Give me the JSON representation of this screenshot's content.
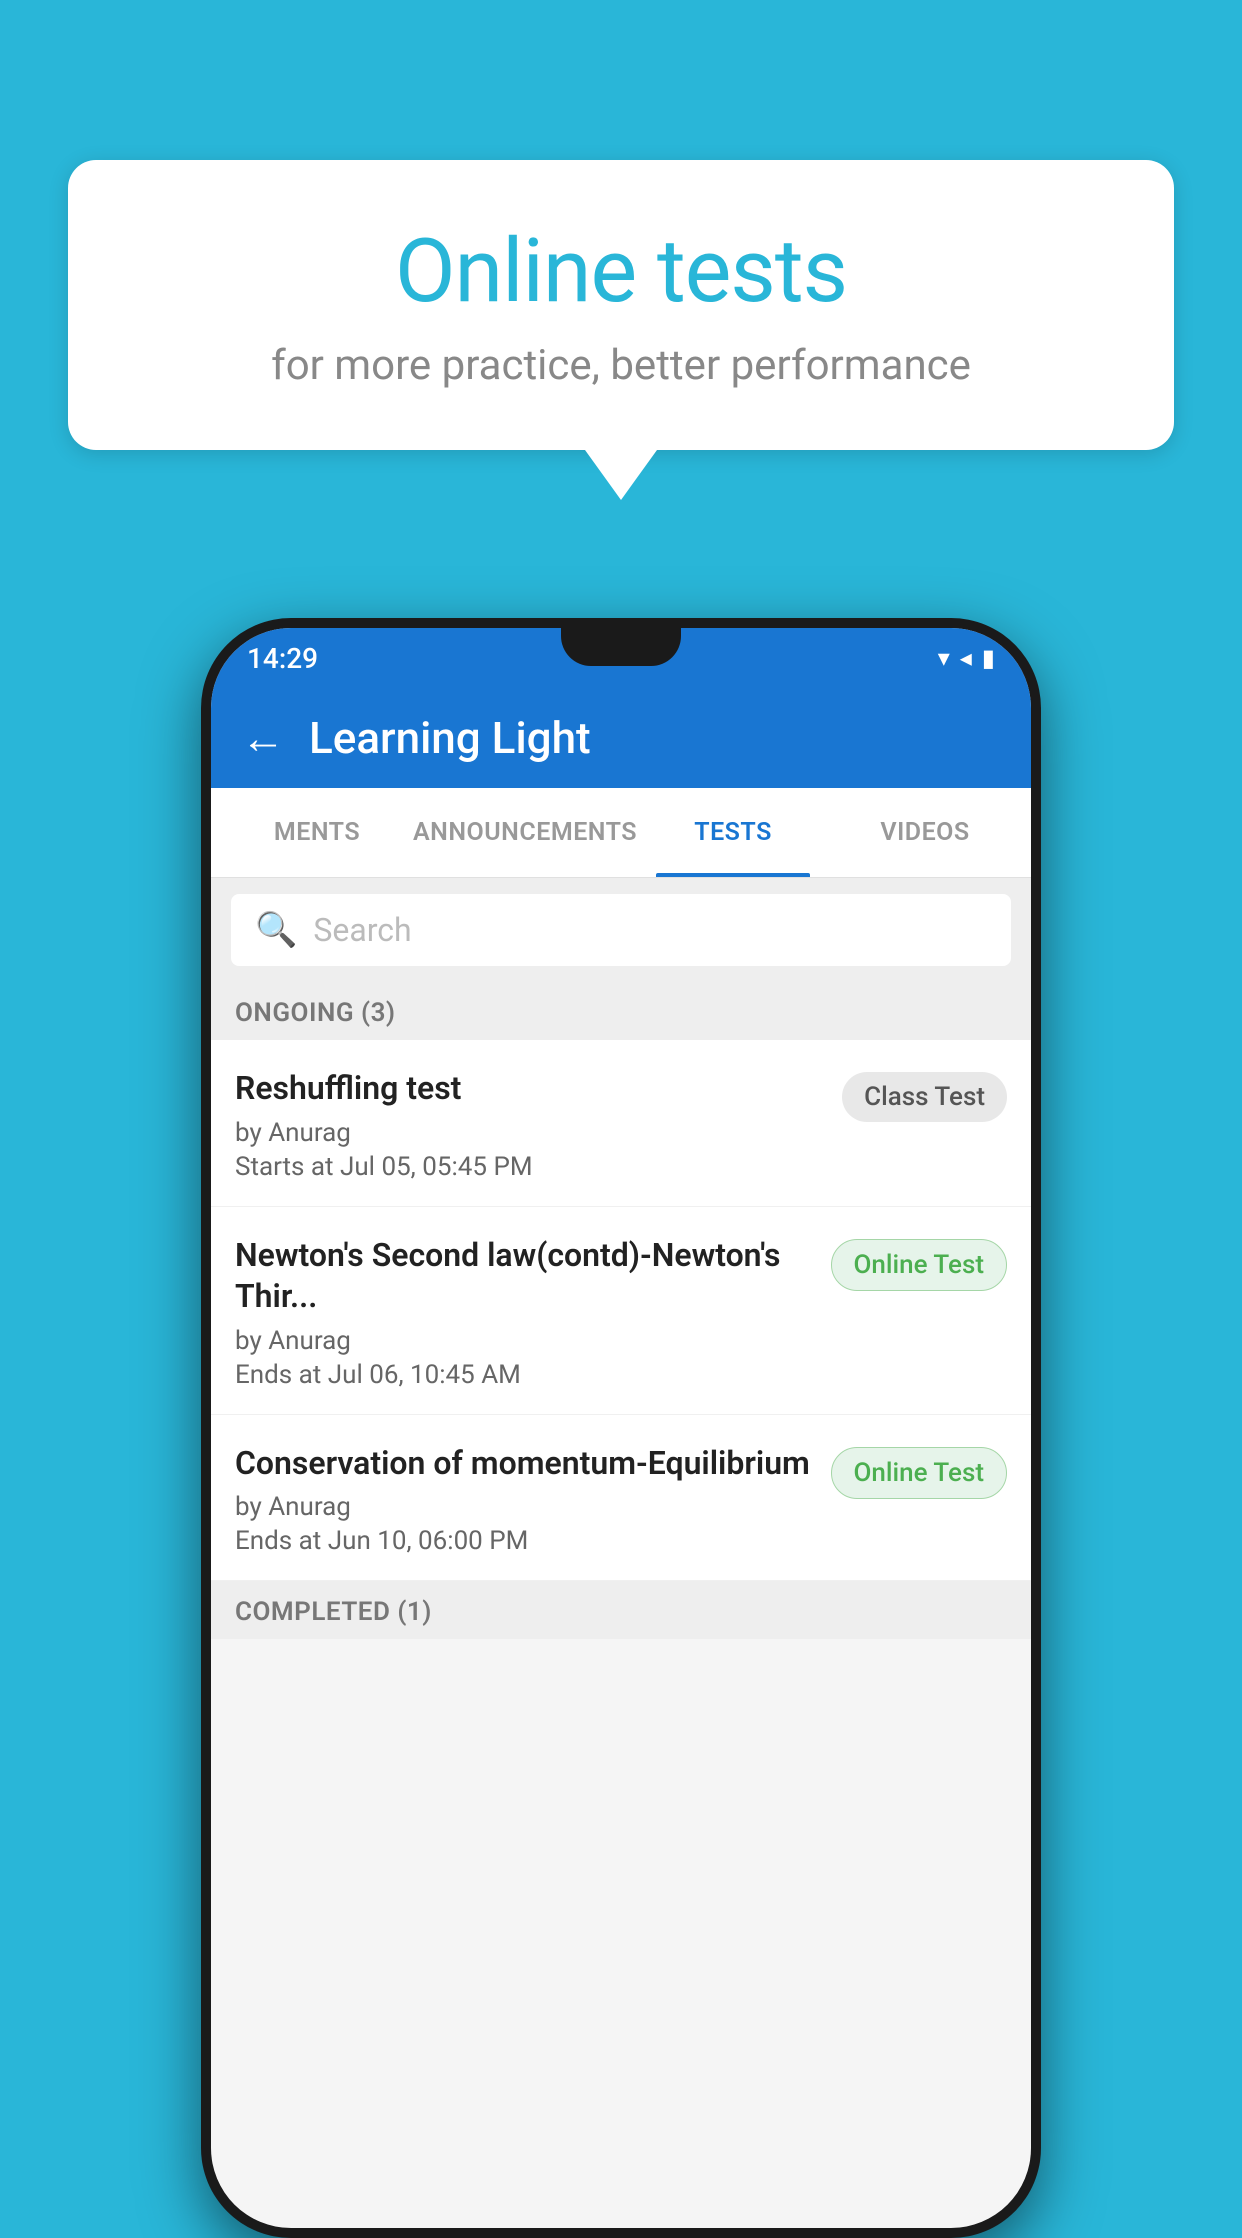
{
  "background_color": "#29b6d8",
  "bubble": {
    "title": "Online tests",
    "subtitle": "for more practice, better performance"
  },
  "phone": {
    "status_bar": {
      "time": "14:29",
      "icons": "▾◂▮"
    },
    "header": {
      "back_label": "←",
      "title": "Learning Light"
    },
    "tabs": [
      {
        "label": "MENTS",
        "active": false
      },
      {
        "label": "ANNOUNCEMENTS",
        "active": false
      },
      {
        "label": "TESTS",
        "active": true
      },
      {
        "label": "VIDEOS",
        "active": false
      }
    ],
    "search": {
      "placeholder": "Search"
    },
    "sections": [
      {
        "title": "ONGOING (3)",
        "tests": [
          {
            "name": "Reshuffling test",
            "author": "by Anurag",
            "date": "Starts at  Jul 05, 05:45 PM",
            "badge": "Class Test",
            "badge_type": "class"
          },
          {
            "name": "Newton's Second law(contd)-Newton's Thir...",
            "author": "by Anurag",
            "date": "Ends at  Jul 06, 10:45 AM",
            "badge": "Online Test",
            "badge_type": "online"
          },
          {
            "name": "Conservation of momentum-Equilibrium",
            "author": "by Anurag",
            "date": "Ends at  Jun 10, 06:00 PM",
            "badge": "Online Test",
            "badge_type": "online"
          }
        ]
      }
    ],
    "completed_header": "COMPLETED (1)"
  }
}
